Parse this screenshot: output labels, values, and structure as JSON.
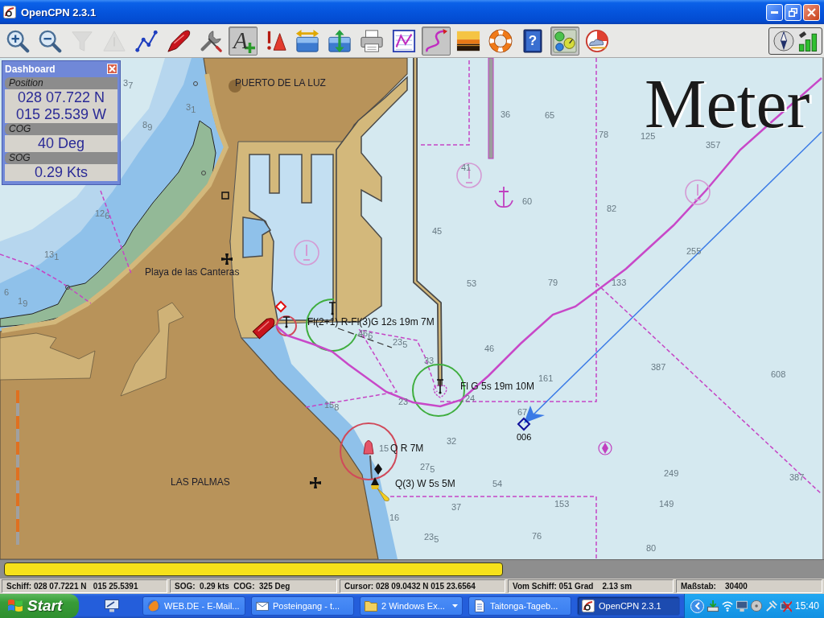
{
  "window": {
    "title": "OpenCPN 2.3.1"
  },
  "toolbar": {
    "buttons": [
      {
        "kind": "zoom-in",
        "disabled": false,
        "pressed": false
      },
      {
        "kind": "zoom-out",
        "disabled": false,
        "pressed": false
      },
      {
        "kind": "scale-in",
        "disabled": true,
        "pressed": false
      },
      {
        "kind": "scale-out",
        "disabled": true,
        "pressed": false
      },
      {
        "kind": "route",
        "disabled": false,
        "pressed": false
      },
      {
        "kind": "ship",
        "disabled": false,
        "pressed": false
      },
      {
        "kind": "settings",
        "disabled": false,
        "pressed": false
      },
      {
        "kind": "text",
        "glyph": "A",
        "disabled": false,
        "pressed": true
      },
      {
        "kind": "ais",
        "disabled": false,
        "pressed": false
      },
      {
        "kind": "tide",
        "disabled": false,
        "pressed": false
      },
      {
        "kind": "current",
        "disabled": false,
        "pressed": false
      },
      {
        "kind": "print",
        "disabled": false,
        "pressed": false
      },
      {
        "kind": "route-manager",
        "disabled": false,
        "pressed": false
      },
      {
        "kind": "track",
        "disabled": false,
        "pressed": true
      },
      {
        "kind": "color-scheme",
        "disabled": false,
        "pressed": false
      },
      {
        "kind": "mob",
        "disabled": false,
        "pressed": false
      },
      {
        "kind": "help",
        "glyph": "?",
        "disabled": false,
        "pressed": false
      },
      {
        "kind": "dashboard",
        "disabled": false,
        "pressed": true
      },
      {
        "kind": "grib",
        "disabled": false,
        "pressed": false
      }
    ]
  },
  "dashboard": {
    "title": "Dashboard",
    "instruments": [
      {
        "label": "Position",
        "values": [
          "028 07.722 N",
          "015 25.539 W"
        ]
      },
      {
        "label": "COG",
        "values": [
          "40 Deg"
        ]
      },
      {
        "label": "SOG",
        "values": [
          "0.29 Kts"
        ]
      }
    ]
  },
  "chart": {
    "unit_label": "Meter",
    "place_names": [
      "PUERTO DE LA LUZ",
      "Playa de las Canteras",
      "LAS PALMAS"
    ],
    "light_labels": [
      "Fl(2+1) R-Fl(3)G 12s 19m 7M",
      "Fl G 5s 19m 10M",
      "Q R 7M",
      "Q(3) W 5s 5M"
    ],
    "waypoint": {
      "label": "006"
    },
    "soundings": [
      "3$_{7}$",
      "3$_{1}$",
      "36",
      "65",
      "8$_{9}$",
      "78",
      "125",
      "357",
      "41",
      "60",
      "82",
      "12$_{6}$",
      "45",
      "255",
      "13$_{1}$",
      "53",
      "79",
      "133",
      "6",
      "1$_{9}$",
      "46$_{6}$",
      "23$_{5}$",
      "46",
      "33",
      "161",
      "387",
      "608",
      "23",
      "24",
      "15$_{8}$",
      "67",
      "32",
      "15",
      "27$_{5}$",
      "249",
      "387",
      "54",
      "153",
      "149",
      "37",
      "16",
      "23$_{5}$",
      "76",
      "80"
    ]
  },
  "status_bar": {
    "fields": [
      "Schiff: 028 07.7221 N   015 25.5391",
      "SOG:  0.29 kts  COG:  325 Deg",
      "Cursor: 028 09.0432 N 015 23.6564",
      "Vom Schiff: 051 Grad    2.13 sm",
      "Maßstab:    30400"
    ]
  },
  "taskbar": {
    "start": "Start",
    "tasks": [
      {
        "label": "WEB.DE - E-Mail...",
        "selected": false,
        "grouped": false
      },
      {
        "label": "Posteingang - t...",
        "selected": false,
        "grouped": false
      },
      {
        "label": "2 Windows Ex...",
        "selected": false,
        "grouped": true
      },
      {
        "label": "Taitonga-Tageb...",
        "selected": false,
        "grouped": false
      },
      {
        "label": "OpenCPN 2.3.1",
        "selected": true,
        "grouped": false
      }
    ],
    "clock": "15:40"
  }
}
